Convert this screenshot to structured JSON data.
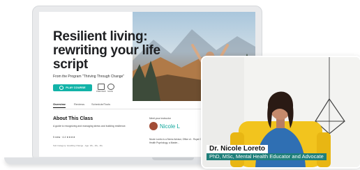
{
  "course": {
    "title": "Resilient living: rewriting your life script",
    "program": "From the Program \"Thriving Through Change\"",
    "play_label": "PLAY COURSE",
    "action_labels": [
      "PREVIEW",
      "SAVE"
    ],
    "tabs": [
      "Overview",
      "Reviews",
      "Schedule/Tools"
    ],
    "about_title": "About This Class",
    "about_text": "A guide to recognizing and managing stress and building resilience.",
    "rating": "5 mins · 4.4 ★★★★",
    "meta": "Sub Category: Handling Change · Age: 18+, 18+, 18+"
  },
  "instructor": {
    "meet_label": "Meet your instructor",
    "name": "Nicole L",
    "bio": "Nicole Loreto is a Senior Advisor, Office of... Royal Ottawa Mental Health Centre in ... Doctorate in Health Psychology, a Master..."
  },
  "video": {
    "name": "Dr. Nicole Loreto",
    "credentials": "PhD, MSc, Mental Health Educator and Advocate"
  },
  "colors": {
    "accent": "#12b3a8",
    "credentials_bg": "#1f7f7a"
  },
  "icons": [
    "close-icon",
    "play-icon",
    "preview-icon",
    "save-icon"
  ]
}
